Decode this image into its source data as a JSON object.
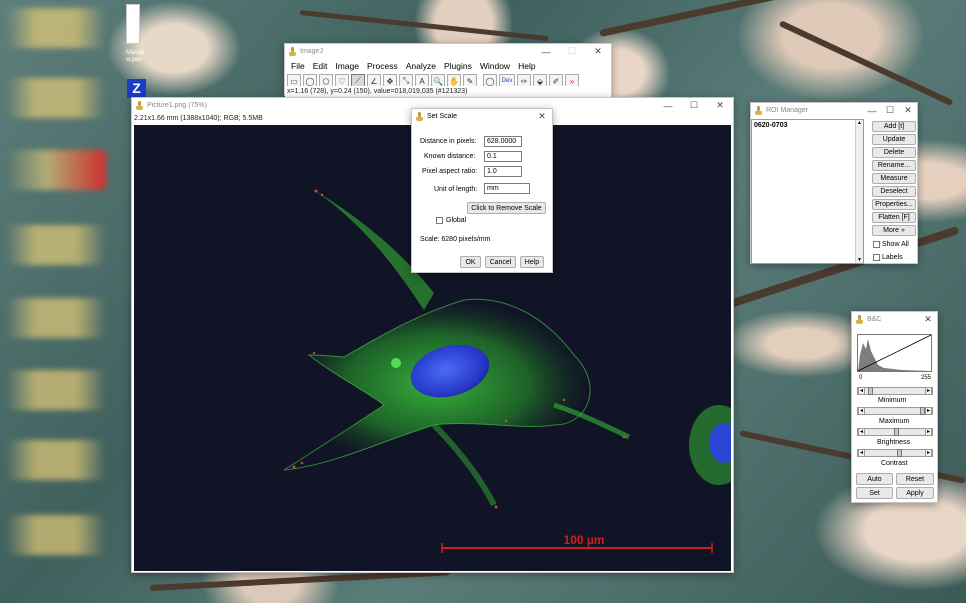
{
  "desktop": {
    "label_top": "Mandu",
    "label_sub": "w.pan",
    "taskbar_letter": "Z"
  },
  "imagej": {
    "title": "ImageJ",
    "menus": [
      "File",
      "Edit",
      "Image",
      "Process",
      "Analyze",
      "Plugins",
      "Window",
      "Help"
    ],
    "tool_glyphs": [
      "▭",
      "◯",
      "⬠",
      "♡",
      "⟋",
      "∠",
      "✥",
      "⤡",
      "A",
      "🔍",
      "✋",
      "✎",
      "◯",
      "Dev",
      "✑",
      "⬙",
      "✐",
      "»"
    ],
    "status": "x=1.16 (728), y=0.24 (150), value=018,019,035 (#121323)"
  },
  "image_window": {
    "title": "Picture1.png (75%)",
    "info": "2.21x1.66 mm (1388x1040); RGB; 5.5MB",
    "scale_bar_label": "100 µm",
    "colors": {
      "scale_bar": "#d51b1b",
      "background": "#101426",
      "nucleus": "#2d4bd8",
      "actin": "#39c23c"
    }
  },
  "set_scale": {
    "title": "Set Scale",
    "fields": [
      {
        "label": "Distance in pixels:",
        "value": "628.0000"
      },
      {
        "label": "Known distance:",
        "value": "0.1"
      },
      {
        "label": "Pixel aspect ratio:",
        "value": "1.0"
      },
      {
        "label": "Unit of length:",
        "value": "mm"
      }
    ],
    "remove_button": "Click to Remove Scale",
    "global_label": "Global",
    "scale_text": "Scale: 6280 pixels/mm",
    "buttons": {
      "ok": "OK",
      "cancel": "Cancel",
      "help": "Help"
    }
  },
  "roi_manager": {
    "title": "ROI Manager",
    "items": [
      "0620-0703"
    ],
    "buttons": [
      "Add [t]",
      "Update",
      "Delete",
      "Rename...",
      "Measure",
      "Deselect",
      "Properties...",
      "Flatten [F]",
      "More »"
    ],
    "checkboxes": [
      "Show All",
      "Labels"
    ]
  },
  "bc": {
    "title": "B&C",
    "hist_min": "0",
    "hist_max": "255",
    "sliders": [
      "Minimum",
      "Maximum",
      "Brightness",
      "Contrast"
    ],
    "buttons": {
      "auto": "Auto",
      "reset": "Reset",
      "set": "Set",
      "apply": "Apply"
    }
  }
}
